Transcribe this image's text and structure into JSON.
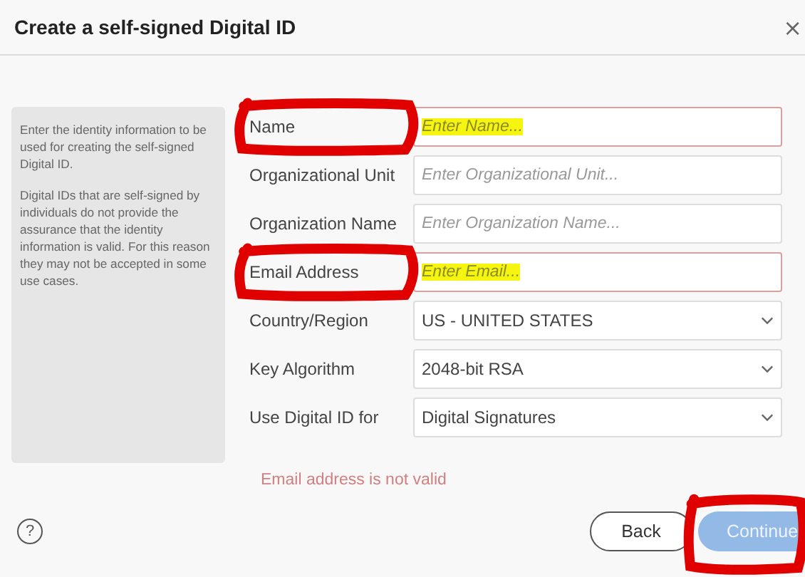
{
  "window": {
    "title": "Create a self-signed Digital ID",
    "close": "×"
  },
  "info_panel": {
    "paragraphs": [
      "Enter the identity information to be used for creating the self-signed Digital ID.",
      "Digital IDs that are self-signed by individuals do not provide the assurance that the identity information is valid. For this reason they may not be accepted in some use cases."
    ]
  },
  "fields": [
    {
      "label": "Name",
      "kind": "text",
      "placeholder": "Enter Name...",
      "error": true,
      "highlighted": true,
      "circled": true
    },
    {
      "label": "Organizational Unit",
      "kind": "text",
      "placeholder": "Enter Organizational Unit...",
      "error": false,
      "highlighted": false,
      "circled": false
    },
    {
      "label": "Organization Name",
      "kind": "text",
      "placeholder": "Enter Organization Name...",
      "error": false,
      "highlighted": false,
      "circled": false
    },
    {
      "label": "Email Address",
      "kind": "text",
      "placeholder": "Enter Email...",
      "error": true,
      "highlighted": true,
      "circled": true
    },
    {
      "label": "Country/Region",
      "kind": "select",
      "value": "US - UNITED STATES",
      "error": false,
      "circled": false
    },
    {
      "label": "Key Algorithm",
      "kind": "select",
      "value": "2048-bit RSA",
      "error": false,
      "circled": false
    },
    {
      "label": "Use Digital ID for",
      "kind": "select",
      "value": "Digital Signatures",
      "error": false,
      "circled": false
    }
  ],
  "error_message": "Email address is not valid",
  "help": "?",
  "buttons": [
    {
      "label": "Back",
      "kind": "secondary",
      "disabled": false,
      "circled": false
    },
    {
      "label": "Continue",
      "kind": "primary",
      "disabled": true,
      "circled": true
    }
  ]
}
